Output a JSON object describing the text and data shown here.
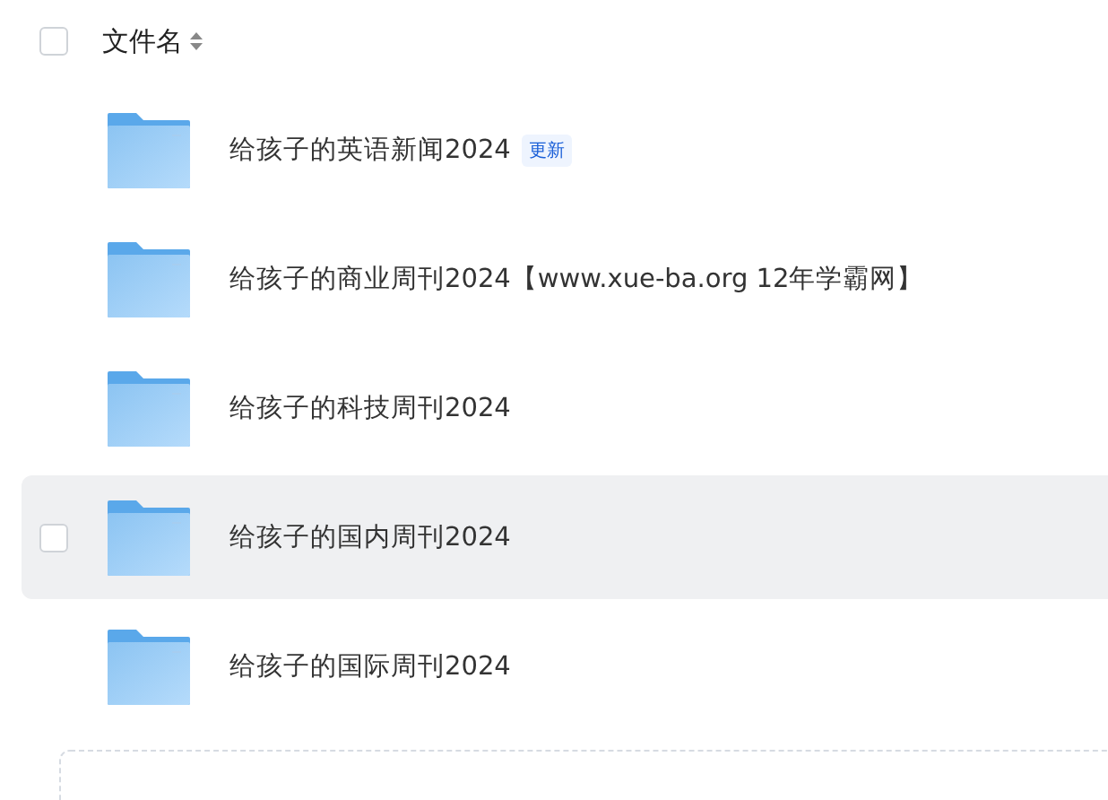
{
  "header": {
    "checkbox_checked": false,
    "column_label": "文件名"
  },
  "files": [
    {
      "name": "给孩子的英语新闻2024",
      "badge": "更新",
      "highlighted": false
    },
    {
      "name": "给孩子的商业周刊2024【www.xue-ba.org 12年学霸网】",
      "highlighted": false
    },
    {
      "name": "给孩子的科技周刊2024",
      "highlighted": false
    },
    {
      "name": "给孩子的国内周刊2024",
      "highlighted": true
    },
    {
      "name": "给孩子的国际周刊2024",
      "highlighted": false
    }
  ]
}
